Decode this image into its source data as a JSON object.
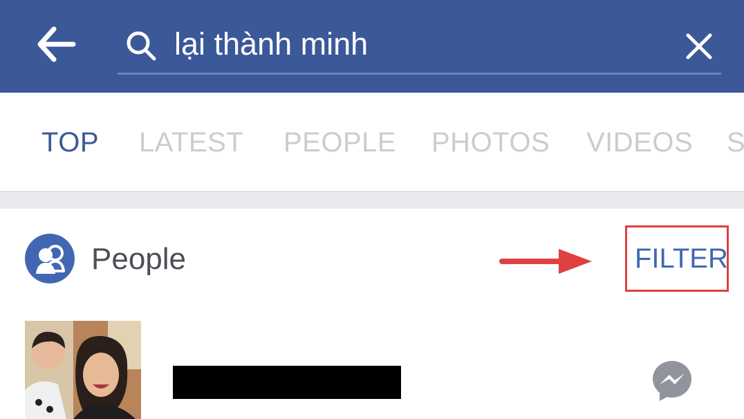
{
  "header": {
    "search_query": "lại thành minh",
    "colors": {
      "bar": "#3b5998",
      "underline": "#6d84b4"
    },
    "icons": {
      "back": "arrow-left-icon",
      "search": "search-icon",
      "clear": "close-icon"
    }
  },
  "tabs": [
    {
      "label": "TOP",
      "active": true
    },
    {
      "label": "LATEST",
      "active": false
    },
    {
      "label": "PEOPLE",
      "active": false
    },
    {
      "label": "PHOTOS",
      "active": false
    },
    {
      "label": "VIDEOS",
      "active": false
    },
    {
      "label": "S",
      "active": false
    }
  ],
  "people_section": {
    "title": "People",
    "filter_label": "FILTER",
    "icons": {
      "section": "people-icon",
      "annotation": "red-arrow-icon"
    },
    "annotation_color": "#e04040"
  },
  "results": [
    {
      "name_redacted": true,
      "action_icon": "messenger-icon"
    }
  ]
}
